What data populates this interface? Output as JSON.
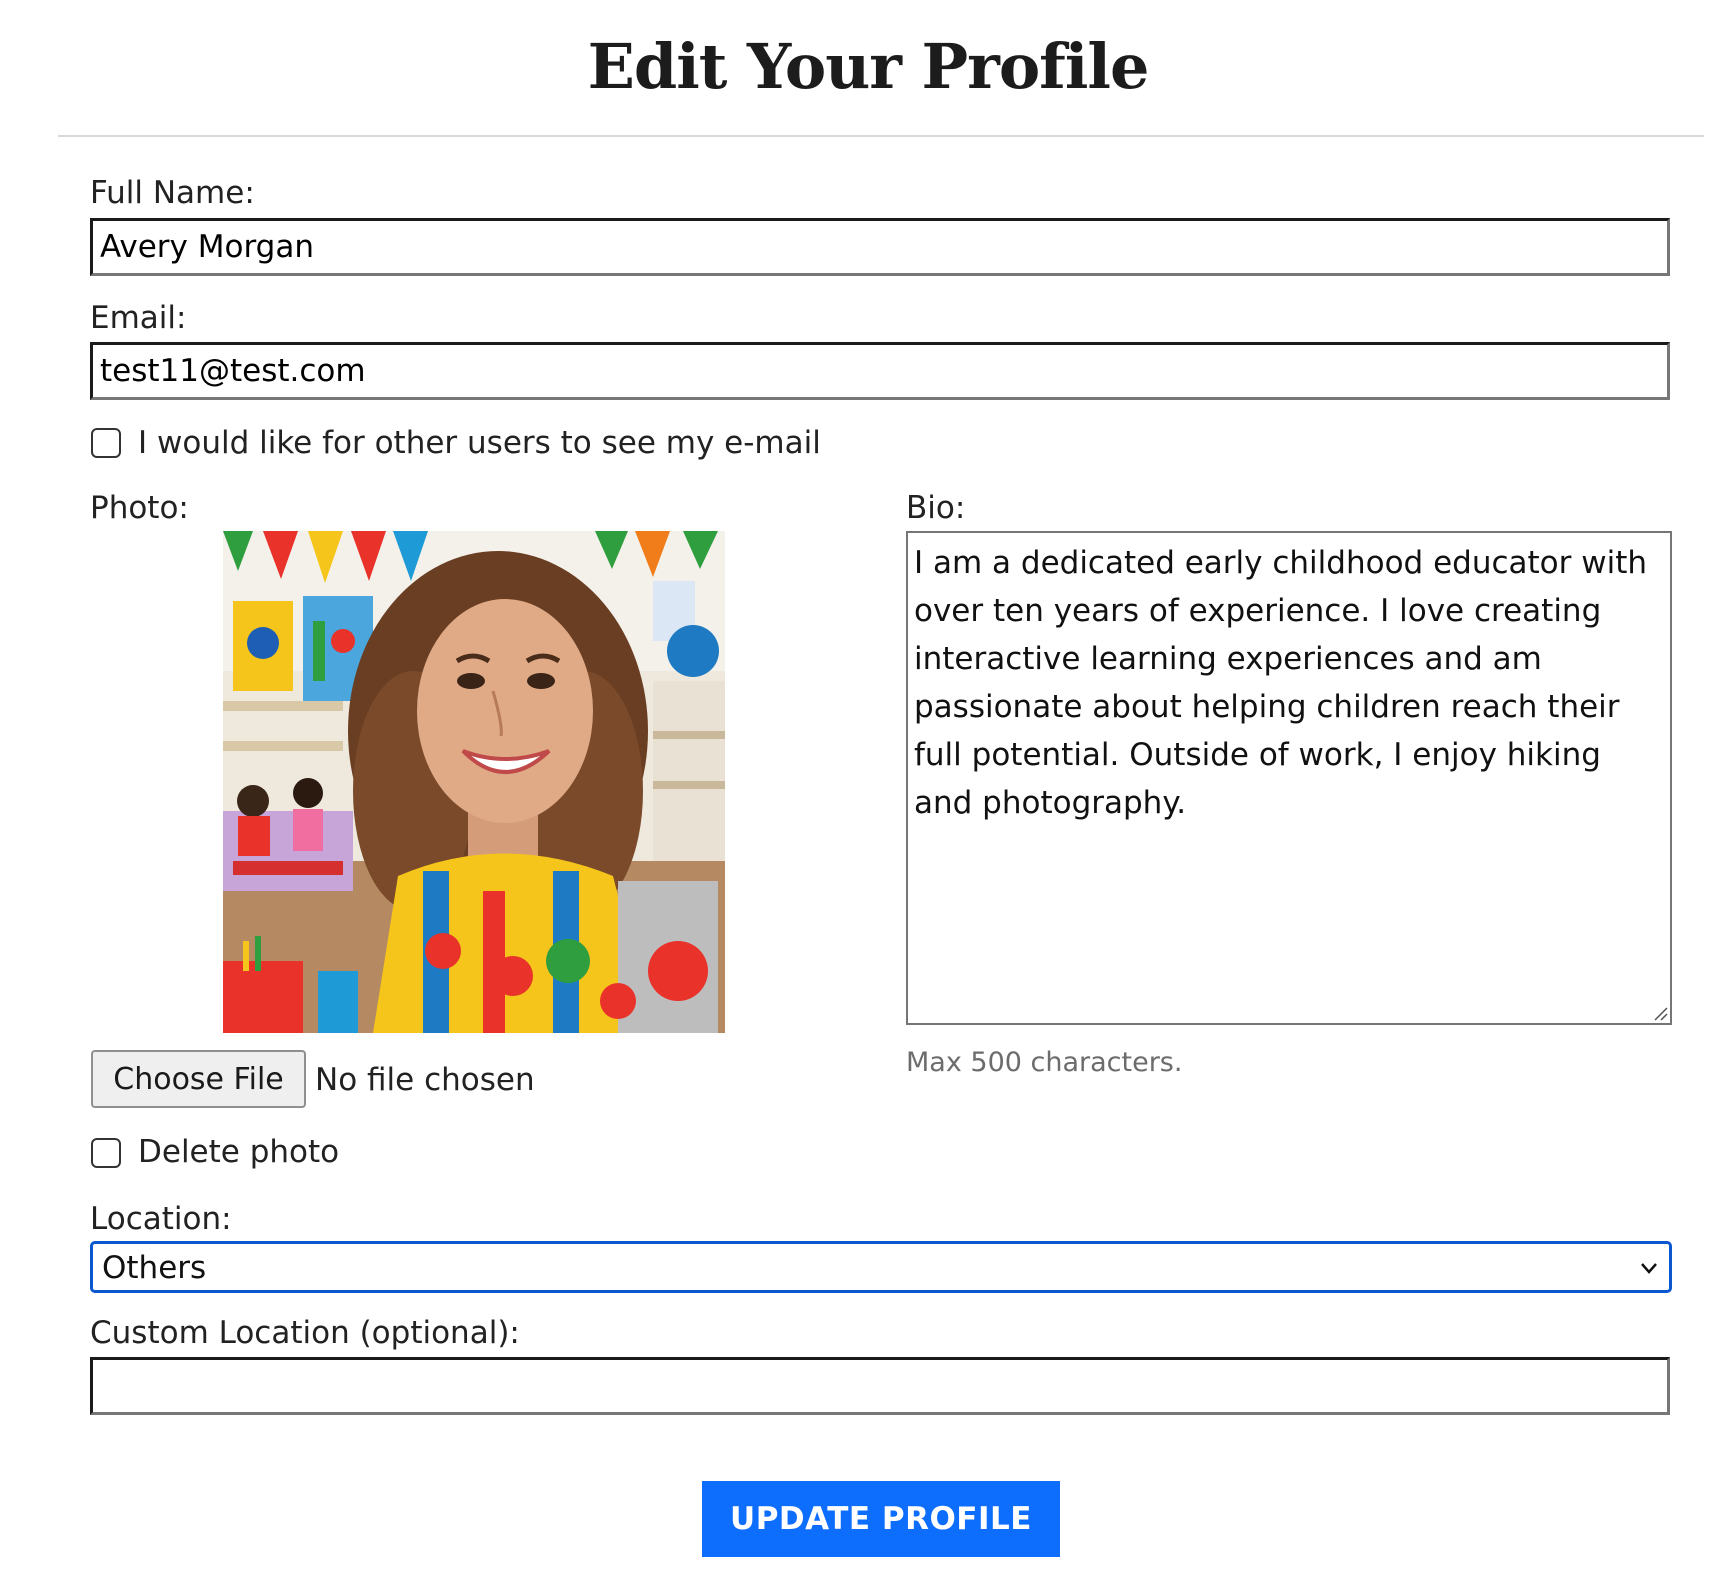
{
  "page": {
    "title": "Edit Your Profile"
  },
  "form": {
    "full_name_label": "Full Name:",
    "full_name_value": "Avery Morgan",
    "email_label": "Email:",
    "email_value": "test11@test.com",
    "show_email_label": "I would like for other users to see my e-mail",
    "show_email_checked": false,
    "photo_label": "Photo:",
    "choose_file_label": "Choose File",
    "file_status": "No file chosen",
    "delete_photo_label": "Delete photo",
    "delete_photo_checked": false,
    "bio_label": "Bio:",
    "bio_value": "I am a dedicated early childhood educator with over ten years of experience. I love creating interactive learning experiences and am passionate about helping children reach their full potential. Outside of work, I enjoy hiking and photography.",
    "bio_helper": "Max 500 characters.",
    "location_label": "Location:",
    "location_selected": "Others",
    "custom_location_label": "Custom Location (optional):",
    "custom_location_value": "",
    "submit_label": "UPDATE PROFILE"
  },
  "colors": {
    "accent": "#0d6efd",
    "focus_ring": "#0b57d0",
    "helper_text": "#6c6c6c"
  },
  "icons": {
    "select_arrow": "chevron-down-icon",
    "textarea_resize": "resize-grip-icon"
  }
}
